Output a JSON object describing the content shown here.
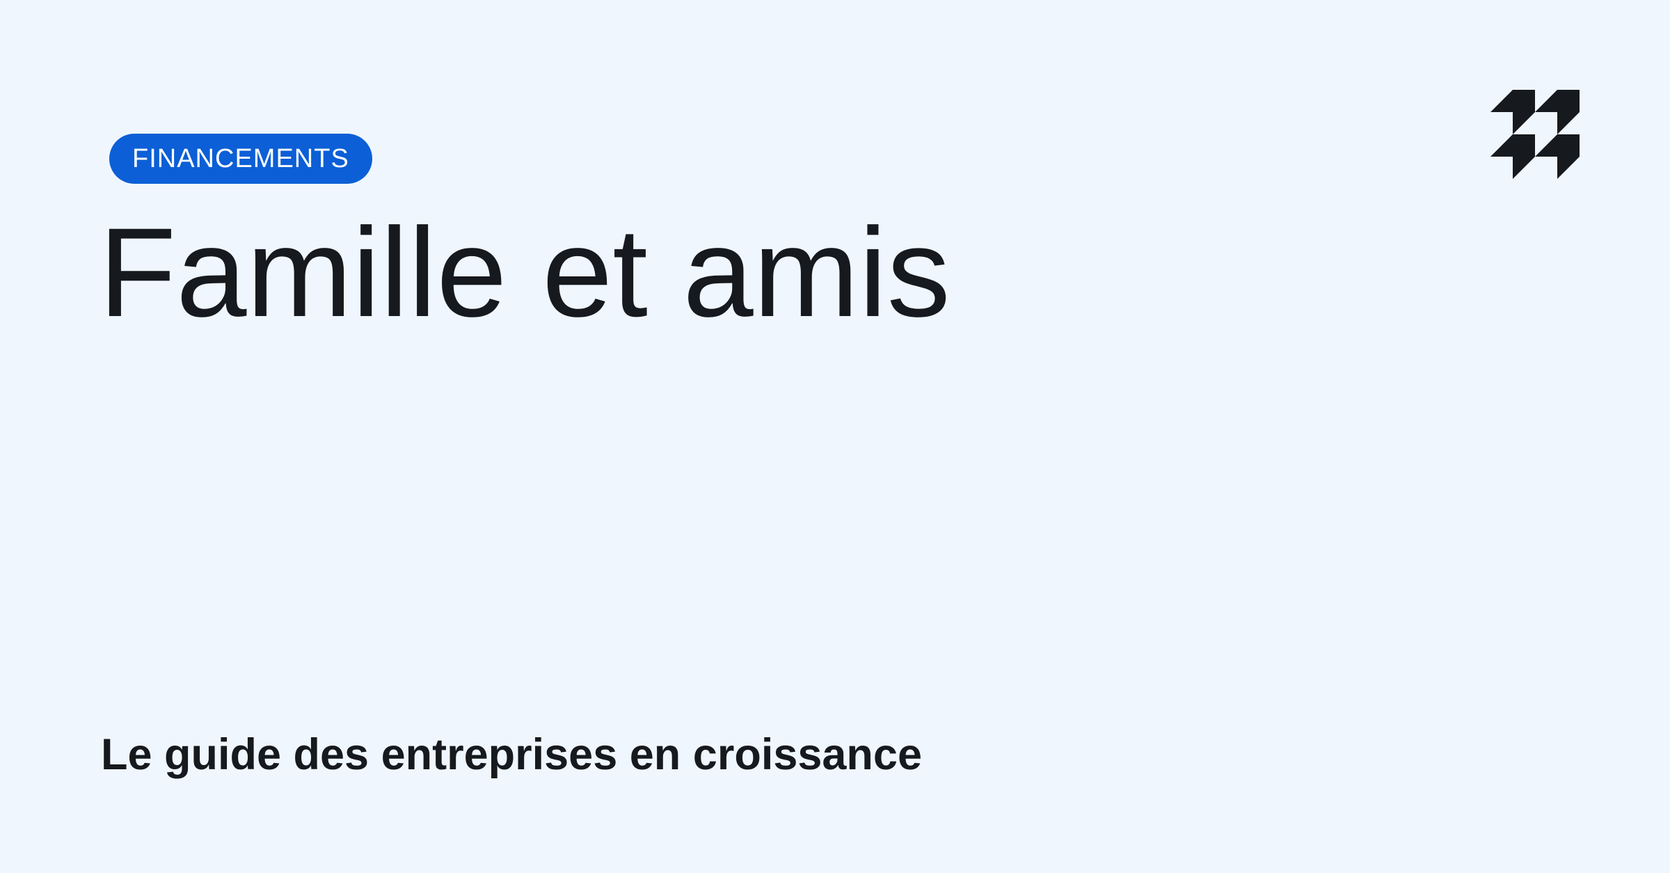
{
  "badge": {
    "label": "FINANCEMENTS",
    "color": "#0c5fd6"
  },
  "title": "Famille et amis",
  "subtitle": "Le guide des entreprises en croissance",
  "logo": {
    "icon": "brand-logo-icon"
  },
  "colors": {
    "background": "#eff6fe",
    "text": "#16191d"
  }
}
